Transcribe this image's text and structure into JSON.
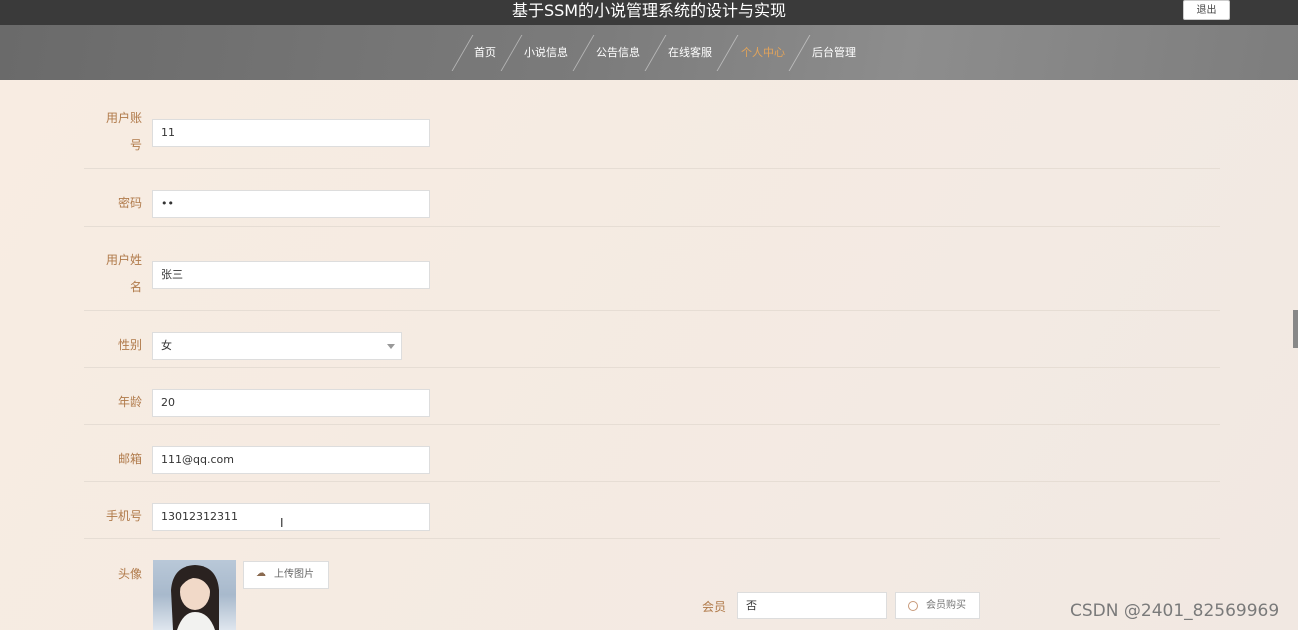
{
  "header": {
    "title": "基于SSM的小说管理系统的设计与实现",
    "logout_label": "退出"
  },
  "nav": {
    "items": [
      {
        "label": "首页"
      },
      {
        "label": "小说信息"
      },
      {
        "label": "公告信息"
      },
      {
        "label": "在线客服"
      },
      {
        "label": "个人中心"
      },
      {
        "label": "后台管理"
      }
    ],
    "active_index": 4,
    "active_color": "#e3a45a"
  },
  "form": {
    "account": {
      "label_line1": "用户账",
      "label_line2": "号",
      "value": "11"
    },
    "password": {
      "label": "密码",
      "value": "••"
    },
    "name": {
      "label_line1": "用户姓",
      "label_line2": "名",
      "value": "张三"
    },
    "gender": {
      "label": "性别",
      "value": "女"
    },
    "age": {
      "label": "年龄",
      "value": "20"
    },
    "email": {
      "label": "邮箱",
      "value": "111@qq.com"
    },
    "phone": {
      "label": "手机号",
      "value": "13012312311"
    },
    "avatar": {
      "label": "头像",
      "upload_label": "上传图片",
      "upload_icon": "cloud-upload-icon"
    },
    "vip": {
      "label": "会员",
      "value": "否",
      "button_label": "会员购买",
      "button_icon": "vip-icon"
    }
  },
  "watermark": "CSDN @2401_82569969",
  "colors": {
    "label": "#b07a4a",
    "topbar": "#3a3a3a"
  }
}
